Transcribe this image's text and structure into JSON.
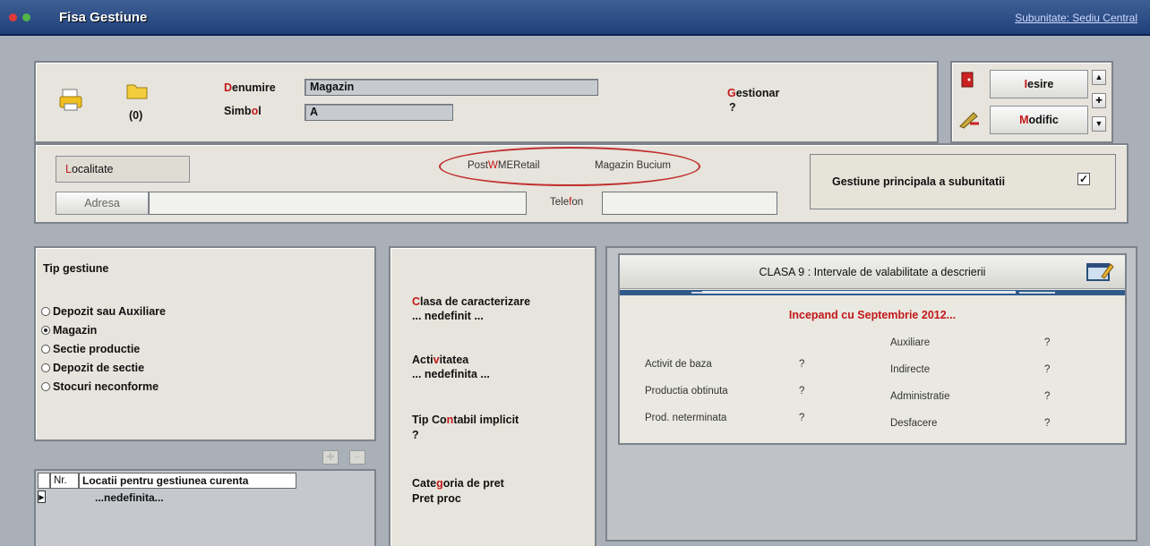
{
  "window": {
    "title": "Fisa Gestiune",
    "subunit_link": "Subunitate: Sediu Central"
  },
  "header": {
    "count": "(0)",
    "denumire_label": "Denumire",
    "denumire_value": "Magazin",
    "simbol_label": "Simbol",
    "simbol_value": "A",
    "gestionar_label": "Gestionar",
    "gestionar_value": "?",
    "exit_label": "Iesire",
    "modify_label": "Modific"
  },
  "location": {
    "localitate_button": "Localitate",
    "adresa_button": "Adresa",
    "adresa_value": "",
    "app_name": "PostWMERetail",
    "shop_name": "Magazin Bucium",
    "telefon_label": "Telefon",
    "telefon_value": "",
    "principal_label": "Gestiune principala a subunitatii",
    "principal_checked": true
  },
  "tip_gestiune": {
    "title": "Tip gestiune",
    "options": [
      "Depozit sau Auxiliare",
      "Magazin",
      "Sectie productie",
      "Depozit de sectie",
      "Stocuri neconforme"
    ],
    "selected": "Magazin"
  },
  "locations_table": {
    "columns": [
      "Nr.",
      "Locatii pentru gestiunea curenta"
    ],
    "rows": [
      "...nedefinita..."
    ]
  },
  "middle": {
    "clasa_label": "Clasa de caracterizare",
    "clasa_value": "... nedefinit ...",
    "activitatea_label": "Activitatea",
    "activitatea_value": "... nedefinita ...",
    "tip_contabil_label": "Tip Contabil implicit",
    "tip_contabil_value": "?",
    "categoria_label": "Categoria de pret",
    "categoria_value": "Pret proc"
  },
  "clasa9": {
    "header": "CLASA 9 : Intervale de valabilitate a descrierii",
    "period": "Incepand cu Septembrie 2012...",
    "left": [
      {
        "label": "Activit de baza",
        "value": "?"
      },
      {
        "label": "Productia obtinuta",
        "value": "?"
      },
      {
        "label": "Prod. neterminata",
        "value": "?"
      }
    ],
    "right": [
      {
        "label": "Auxiliare",
        "value": "?"
      },
      {
        "label": "Indirecte",
        "value": "?"
      },
      {
        "label": "Administratie",
        "value": "?"
      },
      {
        "label": "Desfacere",
        "value": "?"
      }
    ]
  },
  "colors": {
    "accent_red": "#c21818",
    "titlebar": "#2a4a85",
    "ellipse": "#c23030"
  }
}
